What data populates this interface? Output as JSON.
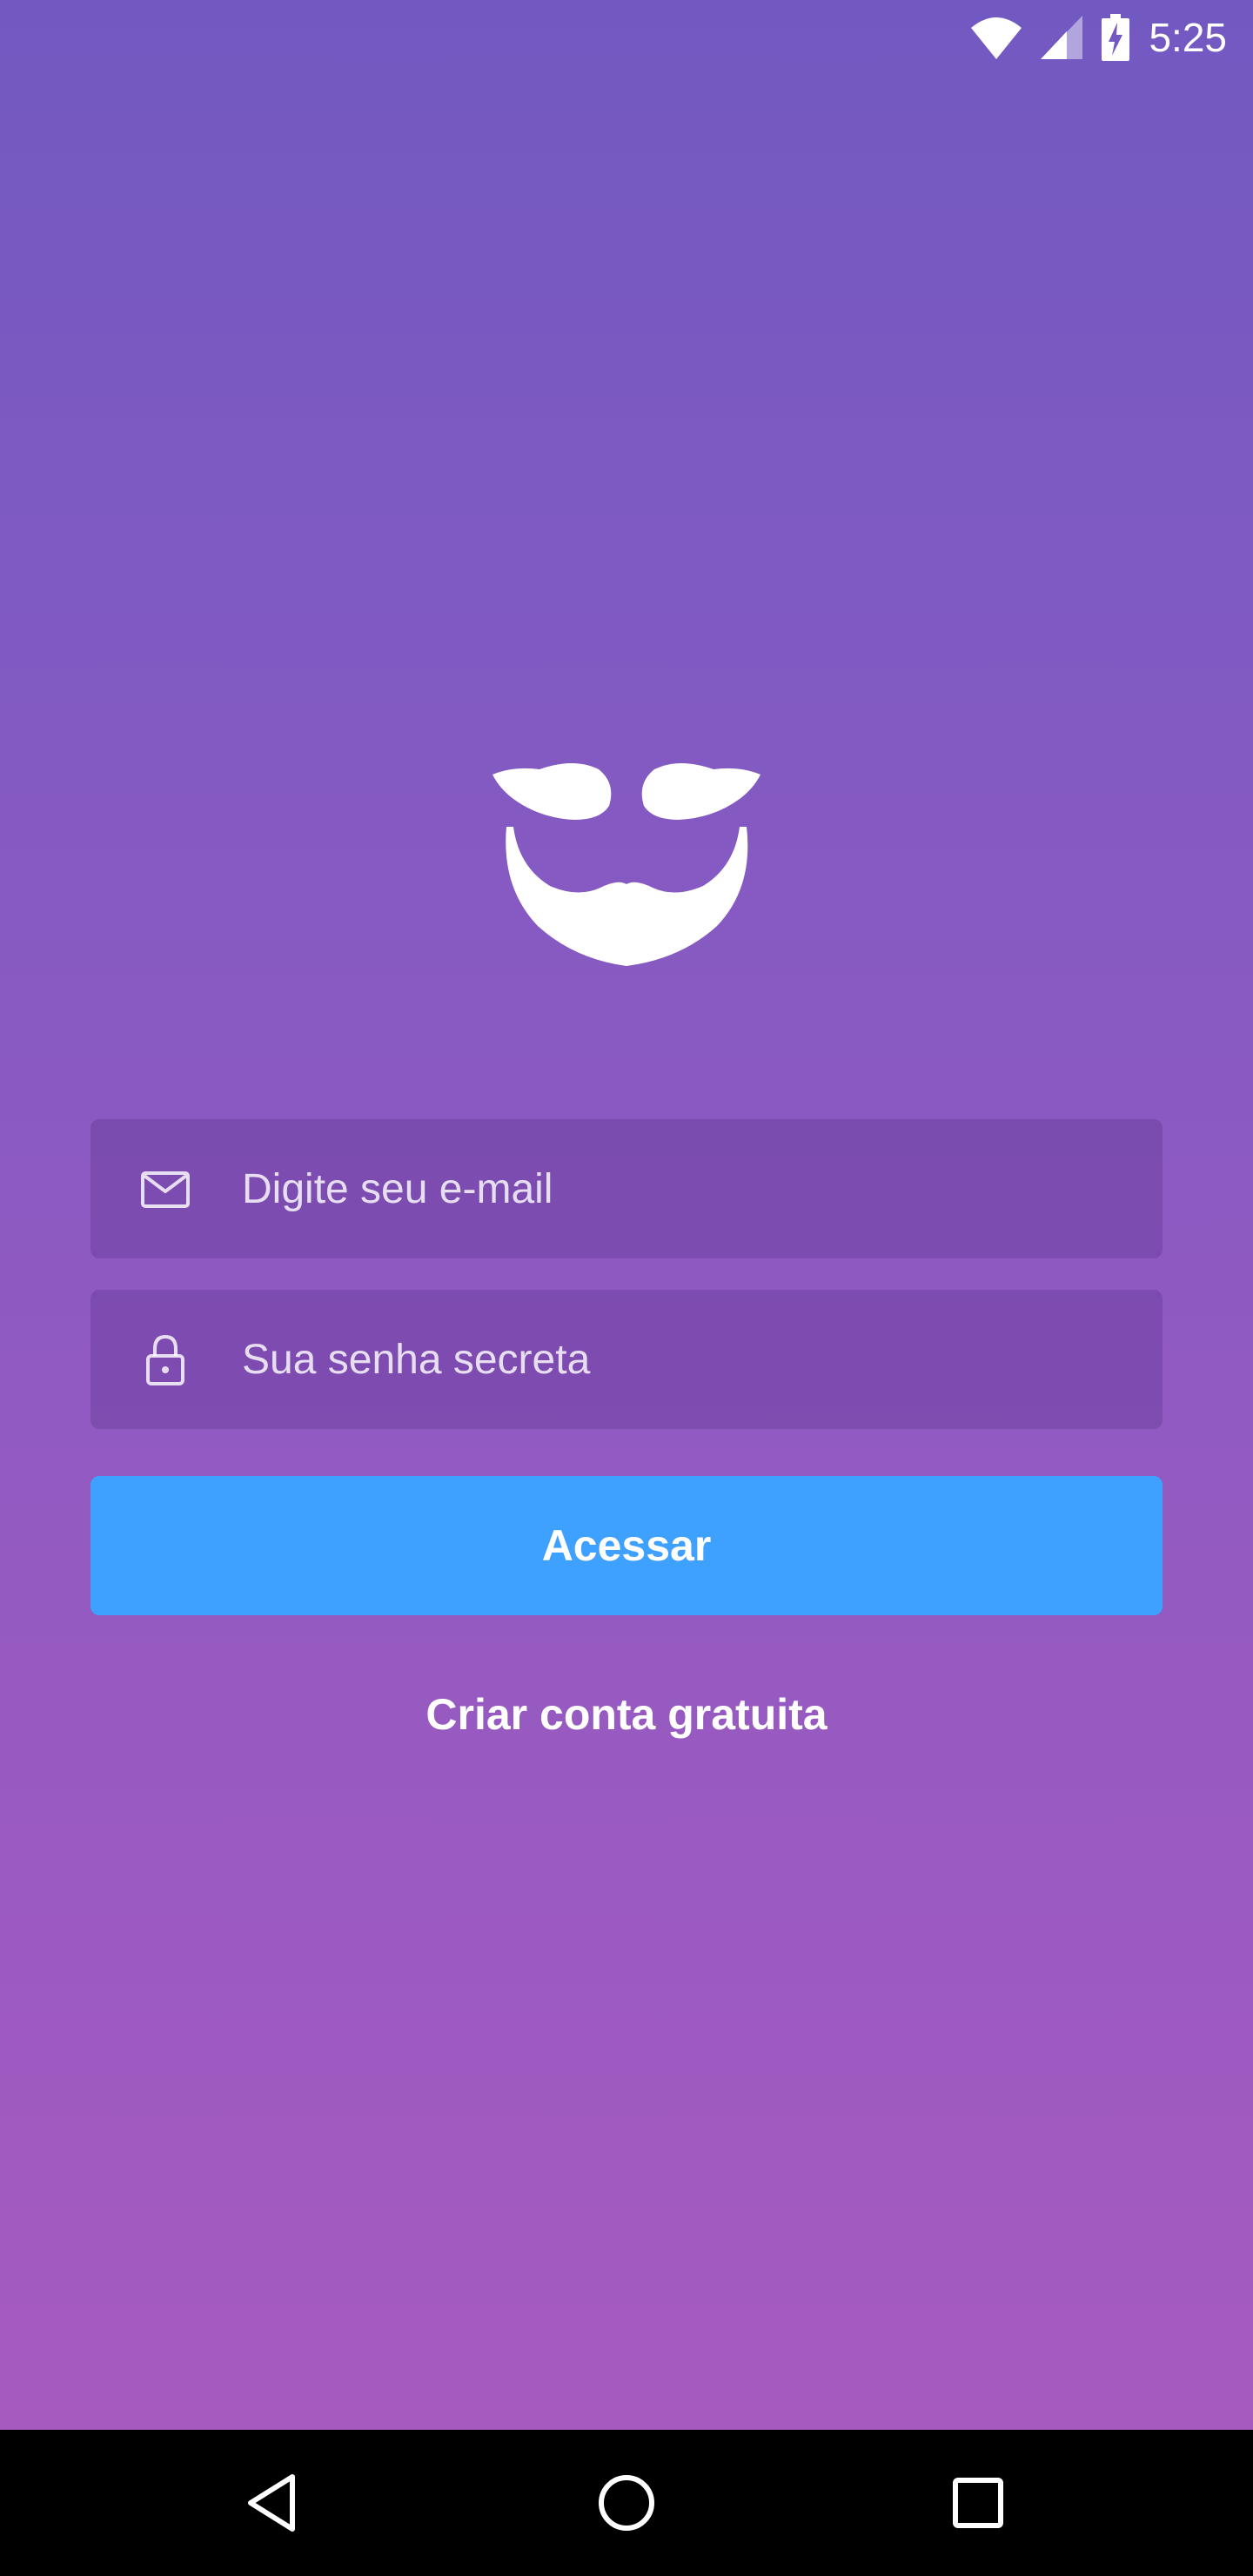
{
  "status_bar": {
    "time": "5:25",
    "icons": [
      "wifi-icon",
      "cell-signal-icon",
      "battery-charging-icon"
    ]
  },
  "logo": {
    "icon": "mustache-beard-icon"
  },
  "login": {
    "email_placeholder": "Digite seu e-mail",
    "email_value": "",
    "email_icon": "mail-icon",
    "password_placeholder": "Sua senha secreta",
    "password_value": "",
    "password_icon": "lock-icon",
    "submit_label": "Acessar",
    "create_account_label": "Criar conta gratuita"
  },
  "nav_bar": {
    "buttons": [
      "back-icon",
      "home-icon",
      "recent-apps-icon"
    ]
  },
  "colors": {
    "gradient_top": "#7259c1",
    "gradient_bottom": "#a65ac0",
    "button_primary": "#3ea0ff",
    "text": "#ffffff",
    "nav_bar": "#000000"
  }
}
